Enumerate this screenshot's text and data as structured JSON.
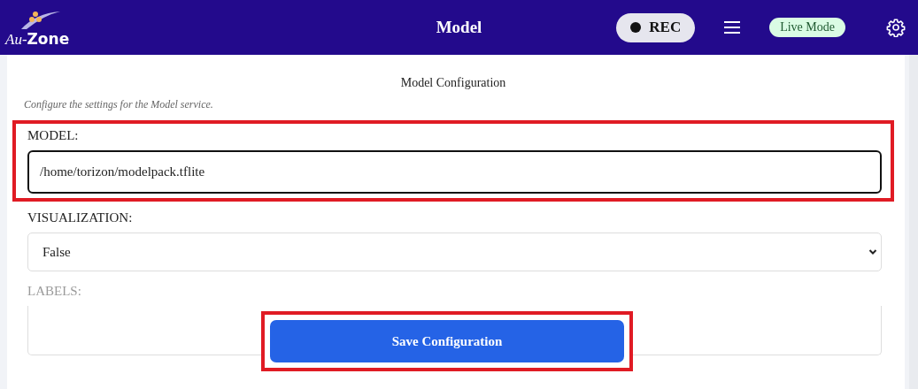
{
  "header": {
    "logo": {
      "prefix": "Au-",
      "suffix": "Zone"
    },
    "title": "Model",
    "rec_button": {
      "label": "REC"
    },
    "mode_badge": "Live Mode"
  },
  "config": {
    "title": "Model Configuration",
    "description": "Configure the settings for the Model service.",
    "fields": [
      {
        "label": "MODEL:",
        "kind": "input",
        "value": "/home/torizon/modelpack.tflite",
        "highlighted": true
      },
      {
        "label": "VISUALIZATION:",
        "kind": "select",
        "value": "False",
        "highlighted": false
      },
      {
        "label": "LABELS:",
        "kind": "textarea",
        "highlighted": false
      }
    ],
    "save_button": {
      "label": "Save Configuration",
      "highlighted": true
    }
  }
}
